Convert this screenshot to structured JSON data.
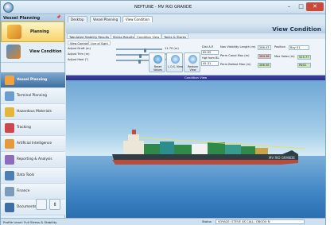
{
  "window": {
    "title": "NEPTUNE - MV RIO GRANDE",
    "minimize": "–",
    "maximize": "□",
    "close": "✕"
  },
  "sidebar": {
    "header": "Vessel Planning",
    "header_pin": "📌",
    "top_buttons": [
      {
        "label": "Planning",
        "icon": "planning-icon"
      },
      {
        "label": "View Condition",
        "icon": "ship-icon"
      }
    ],
    "nav_items": [
      {
        "label": "Vessel Planning",
        "icon": "vessel-icon",
        "active": true
      },
      {
        "label": "Terminal Planning",
        "icon": "terminal-icon"
      },
      {
        "label": "Hazardous Materials",
        "icon": "hazard-icon"
      },
      {
        "label": "Tracking",
        "icon": "tracking-icon"
      },
      {
        "label": "Artificial Intelligence",
        "icon": "ai-icon"
      },
      {
        "label": "Reporting & Analysis",
        "icon": "report-icon"
      },
      {
        "label": "Data Tools",
        "icon": "data-icon"
      },
      {
        "label": "Finance",
        "icon": "finance-icon"
      },
      {
        "label": "Documents",
        "icon": "documents-icon"
      }
    ]
  },
  "tabs": [
    {
      "label": "Desktop",
      "active": false
    },
    {
      "label": "Vessel Planning",
      "active": false
    },
    {
      "label": "View Condition",
      "active": true
    }
  ],
  "header": {
    "title": "View Condition"
  },
  "subtabs": [
    {
      "label": "Tabulated Stability Results",
      "active": false
    },
    {
      "label": "Stress Results",
      "active": false
    },
    {
      "label": "Condition View",
      "active": true
    },
    {
      "label": "Tanks & Stores",
      "active": false
    }
  ],
  "controls": {
    "minitabs": [
      {
        "label": "View Controls",
        "active": false
      },
      {
        "label": "Line of Sight",
        "active": true
      }
    ],
    "sliders": [
      {
        "label": "Adjust Draft (m)",
        "value": "11.70 (m)",
        "level": 0.64
      },
      {
        "label": "Adjust Trim (m)",
        "value": "-0.40 (m)",
        "level": 0.52
      },
      {
        "label": "Adjust Heel (°)",
        "value": "-0.9 (°)",
        "level": 0.5
      }
    ],
    "buttons": [
      {
        "label": "Reset Values",
        "icon": "reset-icon"
      },
      {
        "label": "L.O.S. View",
        "icon": "los-view-icon"
      },
      {
        "label": "Restore View",
        "icon": "restore-view-icon"
      }
    ],
    "dist_ap_label": "Dist A.P.",
    "dist_ap_value": "69.95",
    "hgt_from_bl_label": "Hgt from BL",
    "hgt_from_bl_value": "45.31",
    "non_visibility_label": "Non Visibility Length (m)",
    "non_visibility_value": "286.43",
    "perm_canal_label": "Perm Canal Max (m)",
    "perm_canal_value": "284.36",
    "perm_ballast_label": "Perm Ballast Max (m)",
    "perm_ballast_value": "286.58",
    "position_label": "Position",
    "position_value": "Bay 01",
    "max_solas_label": "Max Solas (m)",
    "max_solas_value": "525.77",
    "pass_value": "PASS"
  },
  "view_bar": "Condition View",
  "scene": {
    "hull_text": "MV RIO GRANDE",
    "sky_color": "#8fbfe3",
    "sea_color": "#3f86c4"
  },
  "footer": {
    "profile": "Profile Level: Full Stress & Stability",
    "status_label": "Status",
    "status_value": "VOYAGE: STEVE AS CALL: OBGOU N"
  }
}
